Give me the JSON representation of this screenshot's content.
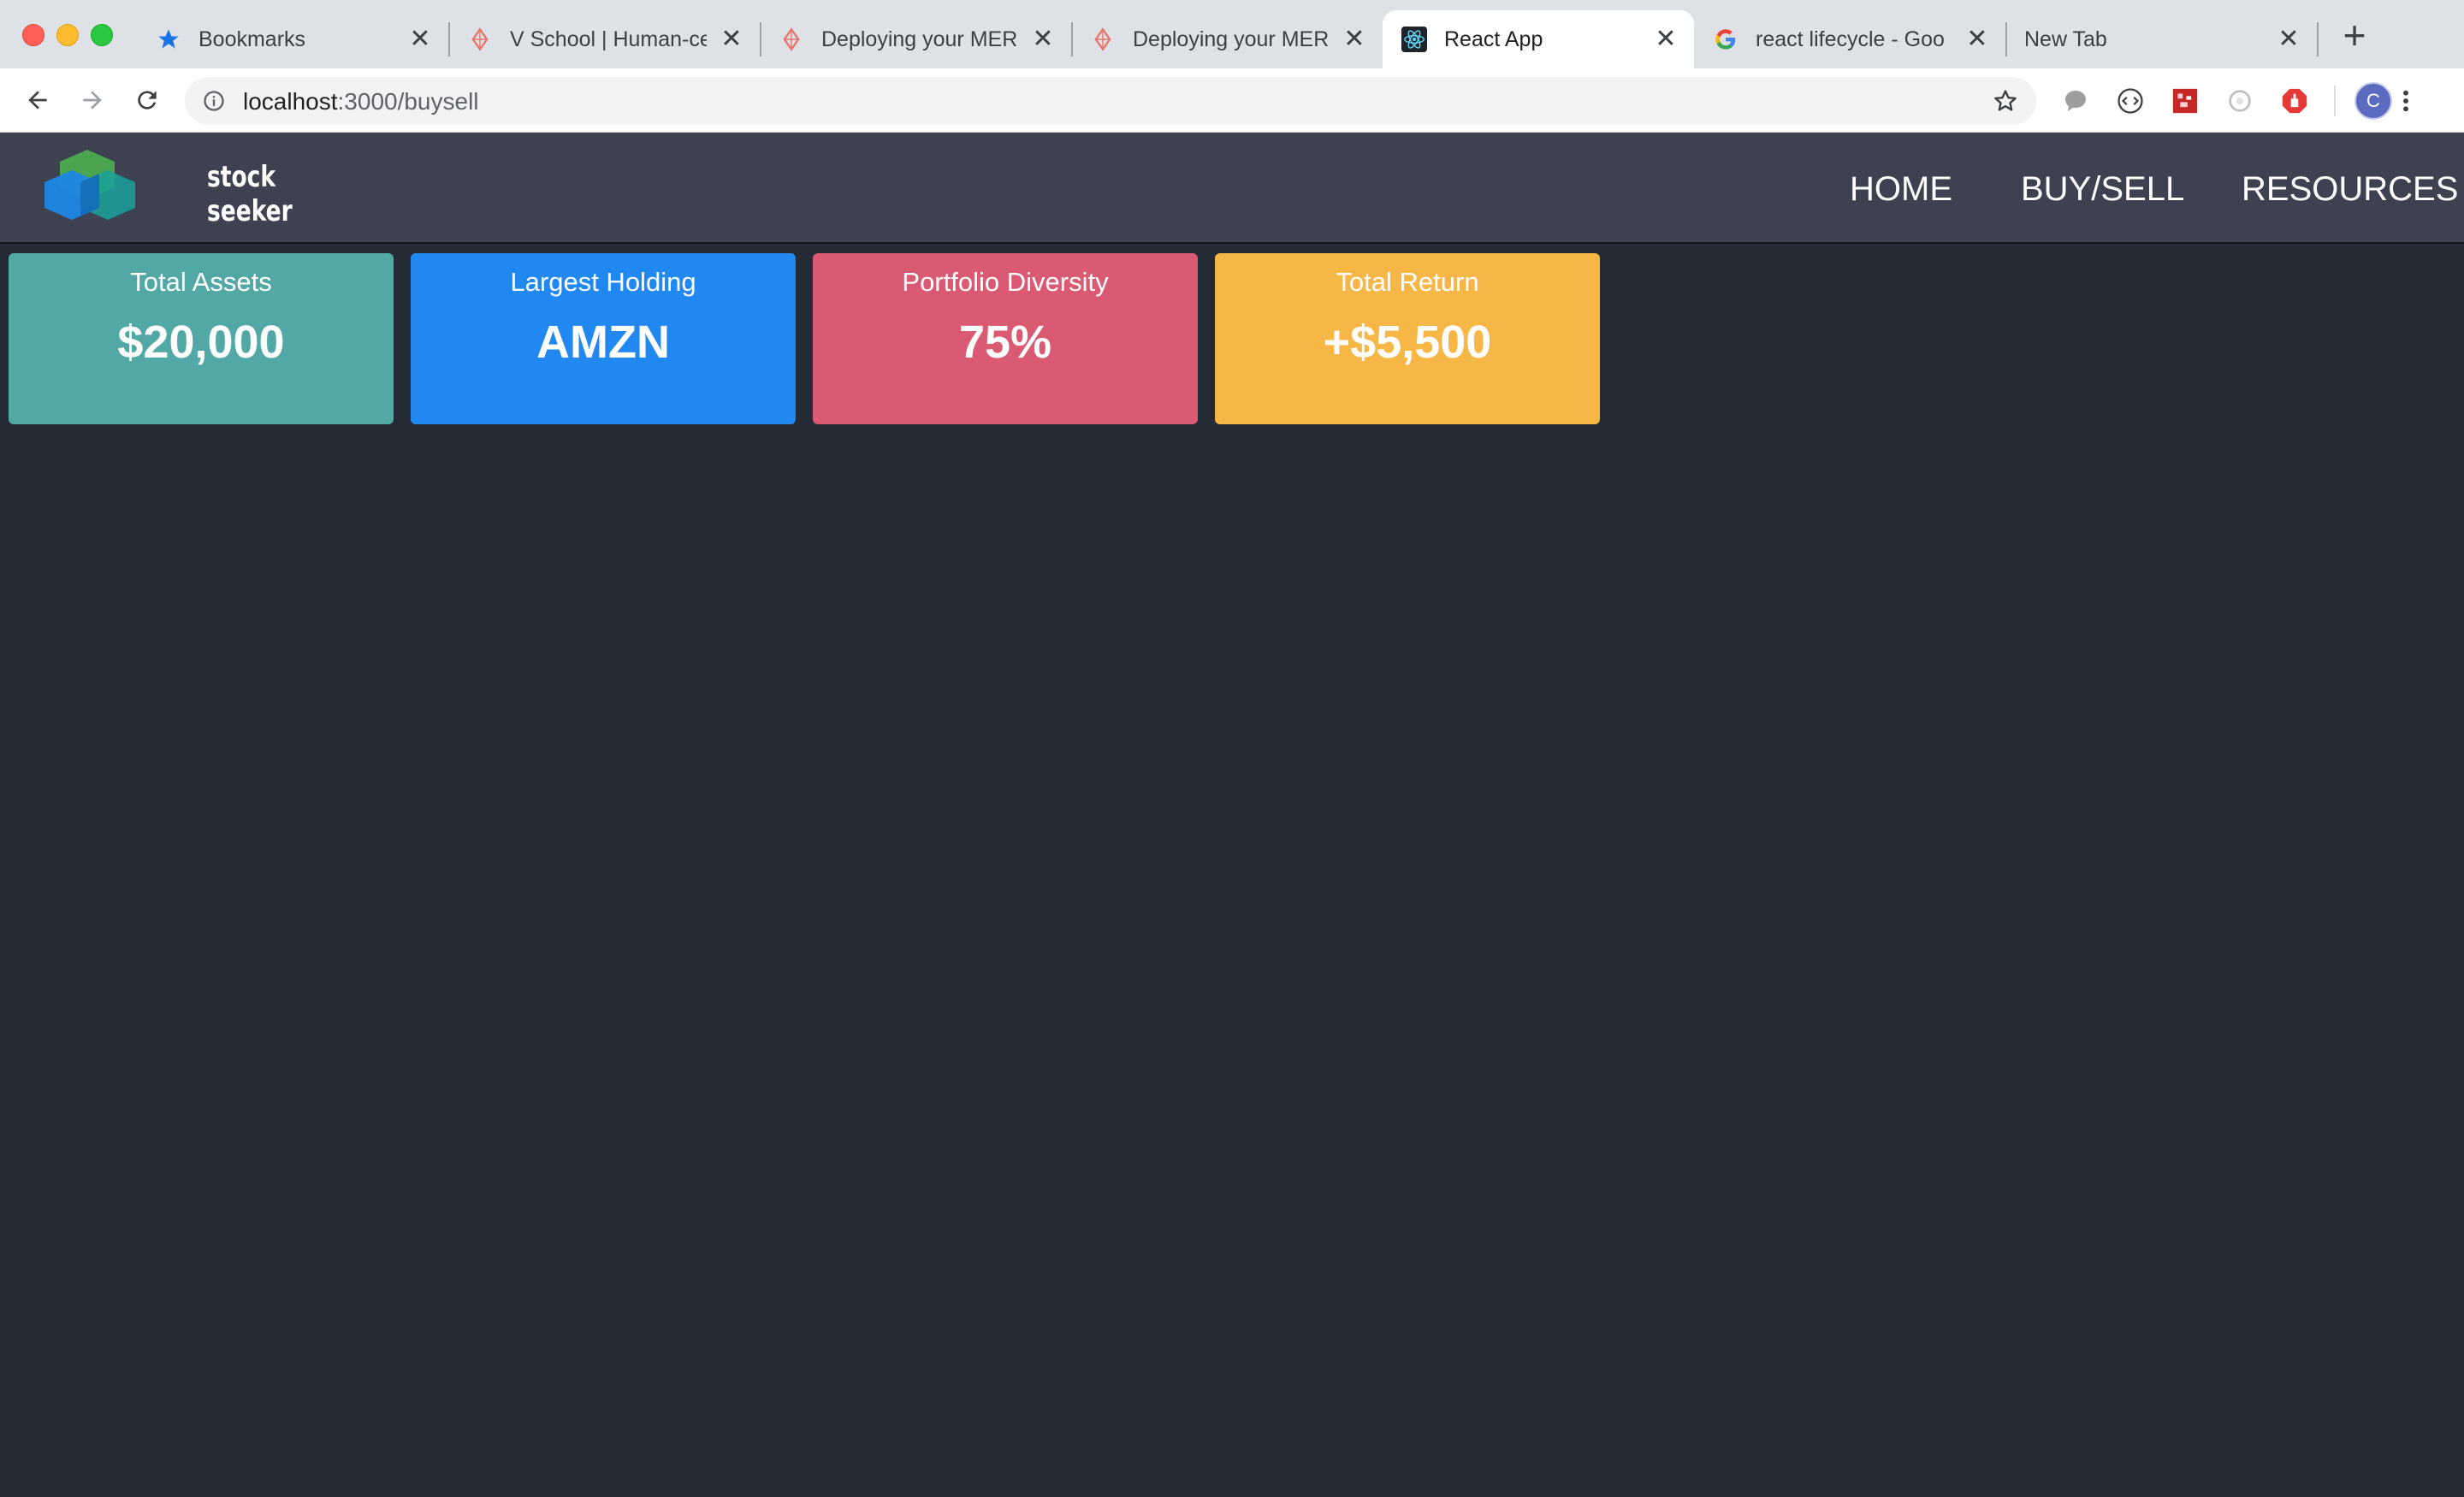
{
  "browser": {
    "tabs": [
      {
        "title": "Bookmarks",
        "icon": "star-icon",
        "active": false
      },
      {
        "title": "V School | Human-ce",
        "icon": "vschool-icon",
        "active": false
      },
      {
        "title": "Deploying your MER",
        "icon": "vschool-icon",
        "active": false
      },
      {
        "title": "Deploying your MER",
        "icon": "vschool-icon",
        "active": false
      },
      {
        "title": "React App",
        "icon": "react-icon",
        "active": true
      },
      {
        "title": "react lifecycle - Goo",
        "icon": "google-icon",
        "active": false
      },
      {
        "title": "New Tab",
        "icon": "",
        "active": false
      }
    ],
    "close_glyph": "✕",
    "new_tab_glyph": "+",
    "address": {
      "host": "localhost",
      "path": ":3000/buysell"
    },
    "profile_initial": "C",
    "extensions": [
      "chat-bubble-icon",
      "code-icon",
      "pixel-ext-icon",
      "sync-icon",
      "adblock-icon"
    ]
  },
  "app": {
    "logo": {
      "line1": "stock",
      "line2": "seeker"
    },
    "nav": [
      {
        "label": "HOME"
      },
      {
        "label": "BUY/SELL"
      },
      {
        "label": "RESOURCES"
      }
    ],
    "cards": [
      {
        "label": "Total Assets",
        "value": "$20,000",
        "color": "#52a8a5"
      },
      {
        "label": "Largest Holding",
        "value": "AMZN",
        "color": "#2188f2"
      },
      {
        "label": "Portfolio Diversity",
        "value": "75%",
        "color": "#db5a73"
      },
      {
        "label": "Total Return",
        "value": "+$5,500",
        "color": "#f6b747"
      }
    ],
    "colors": {
      "background": "#252a37",
      "navbar": "#3d4150"
    }
  }
}
